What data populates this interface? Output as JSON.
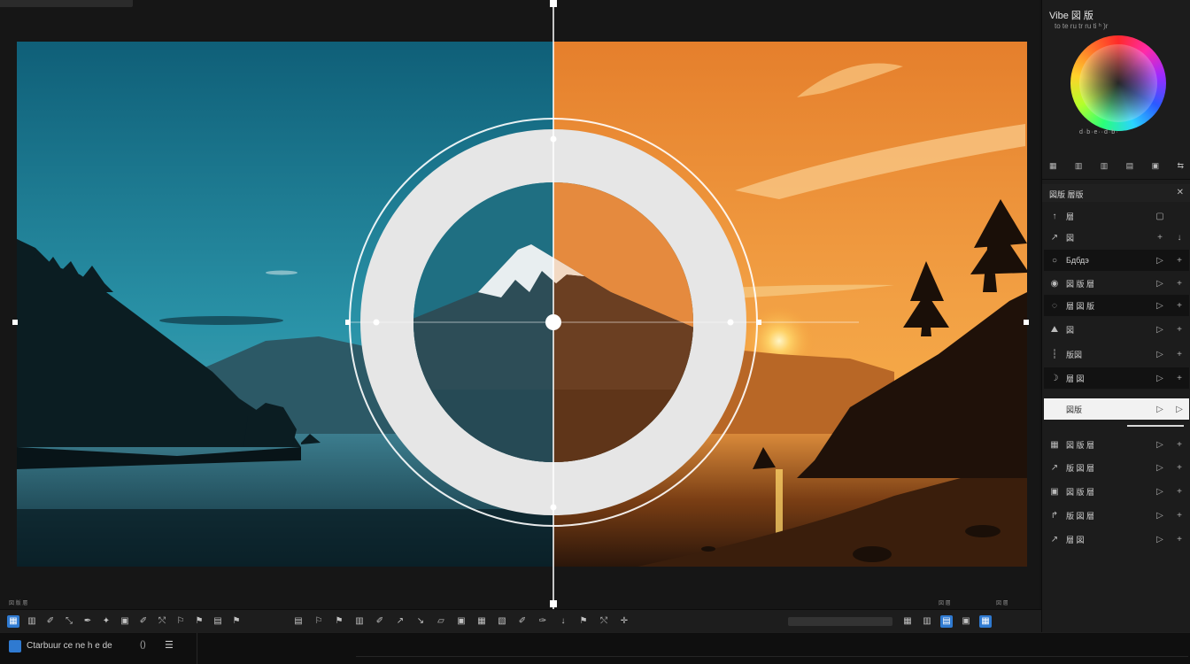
{
  "app": {
    "panel_title": "Vibe 図 版",
    "panel_subtitle": "to te ru tr ru ti ʰ )r",
    "status_name": "Ctarbuur ce ne h e de",
    "status_btn_a": "()",
    "status_btn_b": "☰"
  },
  "colors": {
    "accent": "#2f7ad1",
    "sky_cool": "#1f7f96",
    "sky_warm": "#f3962e",
    "panel_bg": "#1c1c1c"
  },
  "color_wheel": {
    "dots_label": "d·b·e··d·b·"
  },
  "panel_icon_row": [
    "▦",
    "▥",
    "▥",
    "▤",
    "▣",
    "⇆"
  ],
  "layers": {
    "title": "図版 層版",
    "close": "✕",
    "rows": [
      {
        "icon": "↑",
        "label": "層",
        "action_a": "▢",
        "action_b": "",
        "style": "normal"
      },
      {
        "icon": "↗",
        "label": "図",
        "action_a": "+",
        "action_b": "↓",
        "style": "normal"
      },
      {
        "icon": "○",
        "label": "Бдбдэ",
        "action_a": "▷",
        "action_b": "+",
        "style": "dark"
      },
      {
        "icon": "◉",
        "label": "図 版 層",
        "action_a": "▷",
        "action_b": "+",
        "style": "normal"
      },
      {
        "icon": "◌",
        "label": "層 図 版",
        "action_a": "▷",
        "action_b": "+",
        "style": "dark"
      },
      {
        "icon": "⛰",
        "label": "図",
        "action_a": "▷",
        "action_b": "+",
        "style": "normal"
      },
      {
        "icon": "┆",
        "label": "版図",
        "action_a": "▷",
        "action_b": "+",
        "style": "normal"
      },
      {
        "icon": "☽",
        "label": "層 図",
        "action_a": "▷",
        "action_b": "+",
        "style": "dark"
      },
      {
        "icon": "",
        "label": "図版",
        "action_a": "▷",
        "action_b": "▷",
        "style": "light"
      },
      {
        "icon": "▦",
        "label": "図 版 層",
        "action_a": "▷",
        "action_b": "+",
        "style": "normal"
      },
      {
        "icon": "↗",
        "label": "版 図 層",
        "action_a": "▷",
        "action_b": "+",
        "style": "normal"
      },
      {
        "icon": "▣",
        "label": "図 版 層",
        "action_a": "▷",
        "action_b": "+",
        "style": "normal"
      },
      {
        "icon": "↱",
        "label": "版 図 層",
        "action_a": "▷",
        "action_b": "+",
        "style": "normal"
      },
      {
        "icon": "↗",
        "label": "層 図",
        "action_a": "▷",
        "action_b": "+",
        "style": "normal"
      }
    ]
  },
  "toolbar": {
    "left_icons": [
      "▦",
      "▥",
      "✐",
      "⤡",
      "✒",
      "✦",
      "▣",
      "✐",
      "⤲",
      "⚐",
      "⚑",
      "▤",
      "⚑"
    ],
    "mid_icons": [
      "▤",
      "⚐",
      "⚑",
      "▥",
      "✐",
      "↗",
      "↘",
      "▱",
      "▣",
      "▦",
      "▧",
      "✐",
      "✑",
      "↓",
      "⚑",
      "⤲",
      "✛"
    ],
    "right_icons": [
      "▦",
      "▥",
      "▤",
      "▣",
      "▦"
    ],
    "tiny_labels": [
      "図 版 層",
      "図 層",
      "図 層"
    ]
  }
}
